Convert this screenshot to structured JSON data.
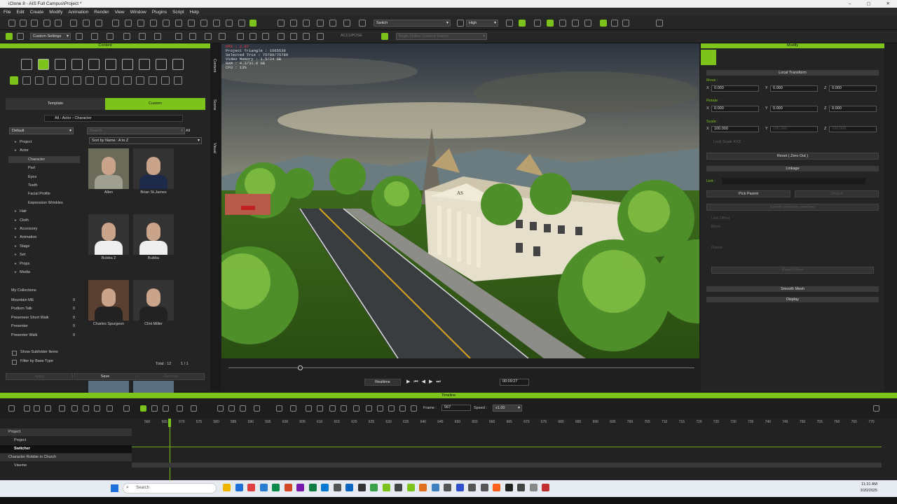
{
  "window": {
    "title": "iClone 8 - AIS Full Campus\\Project *"
  },
  "menu": [
    "File",
    "Edit",
    "Create",
    "Modify",
    "Animation",
    "Render",
    "View",
    "Window",
    "Plugins",
    "Script",
    "Help"
  ],
  "toolbar": {
    "camera": "Switch",
    "quality": "High",
    "preset": "Custom Settings",
    "accupose": "ACCUPOSE",
    "search_placeholder": "Begin Online Content Search"
  },
  "content": {
    "title": "Content",
    "tabs": [
      "Template",
      "Custom"
    ],
    "breadcrumb": [
      "All",
      "Actor",
      "Character"
    ],
    "default_label": "Default",
    "search_placeholder": "Search",
    "all_label": "All",
    "sort": "Sort by Name : A to Z",
    "tree": [
      "Project",
      "Actor",
      "Character",
      "Part",
      "Eyes",
      "Teeth",
      "Facial Profile",
      "Expression Wrinkles",
      "Hair",
      "Cloth",
      "Accessory",
      "Animation",
      "Stage",
      "Set",
      "Props",
      "Media"
    ],
    "collections_title": "My Collections",
    "collections": [
      {
        "name": "Mountain ME",
        "count": "0"
      },
      {
        "name": "Podium Talk",
        "count": "0"
      },
      {
        "name": "Preseneer Short Walk",
        "count": "0"
      },
      {
        "name": "Presenter",
        "count": "0"
      },
      {
        "name": "Presenter Walk",
        "count": "0"
      }
    ],
    "thumbs": [
      "Allen",
      "Brian St.James",
      "Bubba 2",
      "Bubba",
      "Charles Spurgeon",
      "Clint Miller"
    ],
    "cc_badge": "CC3+",
    "show_subfolder": "Show Subfolder Items",
    "filter_base": "Filter by Base Type",
    "total": "Total : 12",
    "page": "1 / 1",
    "apply": "Apply",
    "save": "Save",
    "override": "Override"
  },
  "side_tabs": [
    "Content",
    "Scene",
    "Visual"
  ],
  "viewport": {
    "stats": [
      "FPS : 2.97",
      "Project Triangle : 1565539",
      "Selected Tris : 75789/75789",
      "Video Memory : 1.5/24 GB",
      "RAM : 4.3/31.8 GB",
      "CPU : 13%"
    ],
    "building_letters": "AS",
    "playback_mode": "Realtime",
    "time": "00:09:27"
  },
  "modify": {
    "title": "Modify",
    "local_transform": "Local Transform",
    "move_label": "Move :",
    "rotate_label": "Rotate :",
    "scale_label": "Scale :",
    "move": {
      "x": "0.000",
      "y": "0.000",
      "z": "0.000"
    },
    "rotate": {
      "x": "0.000",
      "y": "0.000",
      "z": "0.000"
    },
    "scale": {
      "x": "100.000",
      "y": "100.000",
      "z": "100.000"
    },
    "lock_scale": "Lock Scale XYZ",
    "reset": "Reset ( Zero Out )",
    "linkage": "Linkage",
    "link_label": "Link :",
    "pick_parent": "Pick Parent",
    "detach": "Detach",
    "link_note": "Enable and keep attached",
    "link_offset": "Link Offset",
    "offset_move": "Move",
    "offset_rotate": "Rotate",
    "reset_offset": "Reset Offset",
    "smooth_mesh": "Smooth Mesh",
    "display": "Display"
  },
  "timeline": {
    "title": "Timeline",
    "frame_label": "Frame :",
    "frame": "567",
    "speed_label": "Speed :",
    "speed": "x1.00",
    "ruler": [
      "560",
      "565",
      "570",
      "575",
      "580",
      "585",
      "590",
      "595",
      "600",
      "605",
      "610",
      "615",
      "620",
      "625",
      "630",
      "635",
      "640",
      "645",
      "650",
      "655",
      "660",
      "665",
      "670",
      "675",
      "680",
      "685",
      "690",
      "695",
      "700",
      "705",
      "710",
      "715",
      "720",
      "725",
      "730",
      "735",
      "740",
      "745",
      "750",
      "755",
      "760",
      "765",
      "770"
    ],
    "tracks": [
      "Project",
      "Project",
      "Switcher",
      "Character Robbie in Church",
      "Viseme"
    ]
  },
  "taskbar": {
    "search": "Search",
    "time": "11:31 AM",
    "date": "3/20/2025"
  },
  "colors": {
    "accent": "#7cc31c",
    "bg": "#1e1e1e",
    "panel": "#242424"
  }
}
